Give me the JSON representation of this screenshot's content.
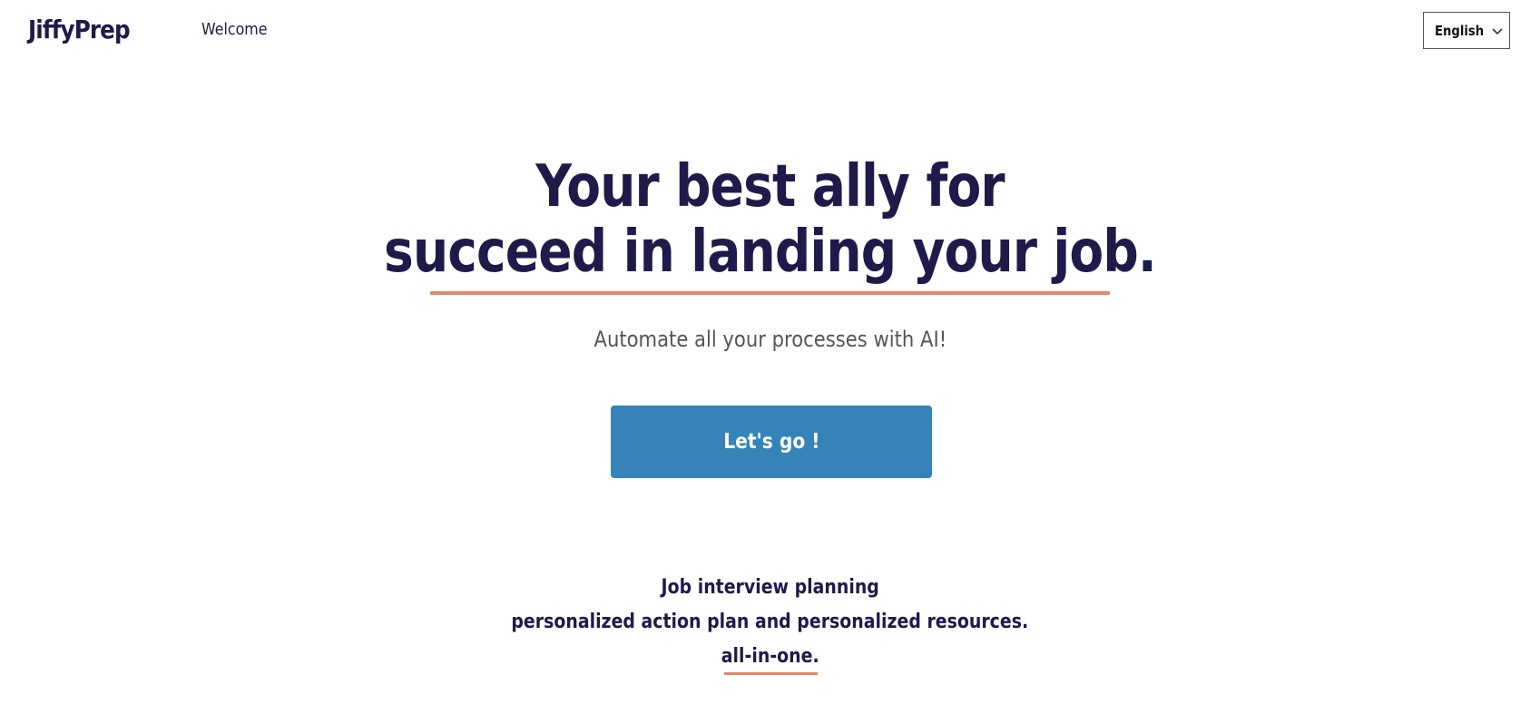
{
  "header": {
    "logo": "JiffyPrep",
    "nav_welcome": "Welcome",
    "language_selected": "English",
    "language_icon": "chevron-down-icon"
  },
  "hero": {
    "title_line1": "Your best ally for",
    "title_line2": "succeed in landing your job.",
    "subtitle": "Automate all your processes with AI!",
    "cta_label": "Let's go !"
  },
  "features": {
    "line1": "Job interview planning",
    "line2": "personalized action plan and personalized resources.",
    "line3": "all-in-one."
  },
  "colors": {
    "primary_text": "#1e1b4b",
    "accent_underline": "#e0886b",
    "button": "#3583b8"
  }
}
